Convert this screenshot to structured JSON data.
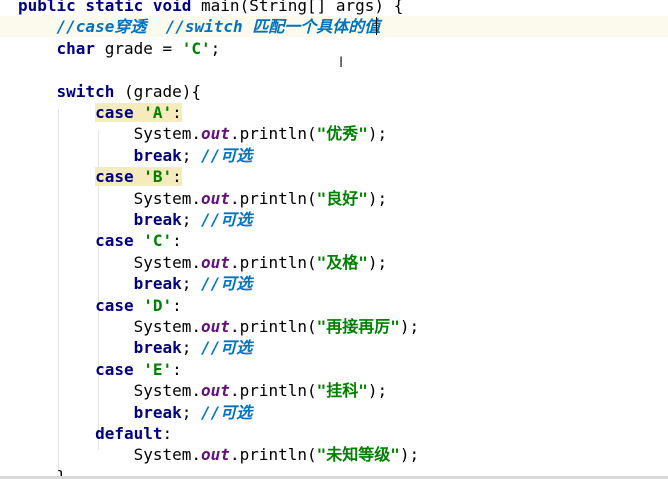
{
  "editor": {
    "lines": [
      [
        {
          "t": "public static void ",
          "c": "kw"
        },
        {
          "t": "main(String[] args) {",
          "c": "plain"
        }
      ],
      [
        {
          "t": "    "
        },
        {
          "t": "//case穿透  //switch 匹配一个具体的值",
          "c": "todo"
        }
      ],
      [
        {
          "t": "    "
        },
        {
          "t": "char ",
          "c": "kw"
        },
        {
          "t": "grade = ",
          "c": "plain"
        },
        {
          "t": "'C'",
          "c": "str"
        },
        {
          "t": ";",
          "c": "plain"
        }
      ],
      [
        {
          "t": ""
        }
      ],
      [
        {
          "t": "    "
        },
        {
          "t": "switch ",
          "c": "kw"
        },
        {
          "t": "(grade){",
          "c": "plain"
        }
      ],
      [
        {
          "t": "        "
        },
        {
          "t": "case ",
          "c": "kw hl"
        },
        {
          "t": "'A'",
          "c": "str hl"
        },
        {
          "t": ":",
          "c": "plain hl"
        }
      ],
      [
        {
          "t": "            "
        },
        {
          "t": "System.",
          "c": "plain"
        },
        {
          "t": "out",
          "c": "field"
        },
        {
          "t": ".println(",
          "c": "plain"
        },
        {
          "t": "\"优秀\"",
          "c": "str"
        },
        {
          "t": ");",
          "c": "plain"
        }
      ],
      [
        {
          "t": "            "
        },
        {
          "t": "break",
          "c": "kw"
        },
        {
          "t": "; ",
          "c": "plain"
        },
        {
          "t": "//可选",
          "c": "todo"
        }
      ],
      [
        {
          "t": "        "
        },
        {
          "t": "case ",
          "c": "kw hl"
        },
        {
          "t": "'B'",
          "c": "str hl"
        },
        {
          "t": ":",
          "c": "plain hl"
        }
      ],
      [
        {
          "t": "            "
        },
        {
          "t": "System.",
          "c": "plain"
        },
        {
          "t": "out",
          "c": "field"
        },
        {
          "t": ".println(",
          "c": "plain"
        },
        {
          "t": "\"良好\"",
          "c": "str"
        },
        {
          "t": ");",
          "c": "plain"
        }
      ],
      [
        {
          "t": "            "
        },
        {
          "t": "break",
          "c": "kw"
        },
        {
          "t": "; ",
          "c": "plain"
        },
        {
          "t": "//可选",
          "c": "todo"
        }
      ],
      [
        {
          "t": "        "
        },
        {
          "t": "case ",
          "c": "kw"
        },
        {
          "t": "'C'",
          "c": "str"
        },
        {
          "t": ":",
          "c": "plain"
        }
      ],
      [
        {
          "t": "            "
        },
        {
          "t": "System.",
          "c": "plain"
        },
        {
          "t": "out",
          "c": "field"
        },
        {
          "t": ".println(",
          "c": "plain"
        },
        {
          "t": "\"及格\"",
          "c": "str"
        },
        {
          "t": ");",
          "c": "plain"
        }
      ],
      [
        {
          "t": "            "
        },
        {
          "t": "break",
          "c": "kw"
        },
        {
          "t": "; ",
          "c": "plain"
        },
        {
          "t": "//可选",
          "c": "todo"
        }
      ],
      [
        {
          "t": "        "
        },
        {
          "t": "case ",
          "c": "kw"
        },
        {
          "t": "'D'",
          "c": "str"
        },
        {
          "t": ":",
          "c": "plain"
        }
      ],
      [
        {
          "t": "            "
        },
        {
          "t": "System.",
          "c": "plain"
        },
        {
          "t": "out",
          "c": "field"
        },
        {
          "t": ".println(",
          "c": "plain"
        },
        {
          "t": "\"再接再厉\"",
          "c": "str"
        },
        {
          "t": ");",
          "c": "plain"
        }
      ],
      [
        {
          "t": "            "
        },
        {
          "t": "break",
          "c": "kw"
        },
        {
          "t": "; ",
          "c": "plain"
        },
        {
          "t": "//可选",
          "c": "todo"
        }
      ],
      [
        {
          "t": "        "
        },
        {
          "t": "case ",
          "c": "kw"
        },
        {
          "t": "'E'",
          "c": "str"
        },
        {
          "t": ":",
          "c": "plain"
        }
      ],
      [
        {
          "t": "            "
        },
        {
          "t": "System.",
          "c": "plain"
        },
        {
          "t": "out",
          "c": "field"
        },
        {
          "t": ".println(",
          "c": "plain"
        },
        {
          "t": "\"挂科\"",
          "c": "str"
        },
        {
          "t": ");",
          "c": "plain"
        }
      ],
      [
        {
          "t": "            "
        },
        {
          "t": "break",
          "c": "kw"
        },
        {
          "t": "; ",
          "c": "plain"
        },
        {
          "t": "//可选",
          "c": "todo"
        }
      ],
      [
        {
          "t": "        "
        },
        {
          "t": "default",
          "c": "kw"
        },
        {
          "t": ":",
          "c": "plain"
        }
      ],
      [
        {
          "t": "            "
        },
        {
          "t": "System.",
          "c": "plain"
        },
        {
          "t": "out",
          "c": "field"
        },
        {
          "t": ".println(",
          "c": "plain"
        },
        {
          "t": "\"未知等级\"",
          "c": "str"
        },
        {
          "t": ");",
          "c": "plain"
        }
      ],
      [
        {
          "t": "    "
        },
        {
          "t": "}",
          "c": "plain"
        }
      ]
    ]
  },
  "colors": {
    "keyword": "#000080",
    "string": "#008000",
    "static_field": "#660e7a",
    "todo_comment": "#0073bf",
    "current_line": "#fcfaed",
    "highlight": "#f6ebbc"
  },
  "cursor": {
    "icon": "text-cursor-icon"
  }
}
